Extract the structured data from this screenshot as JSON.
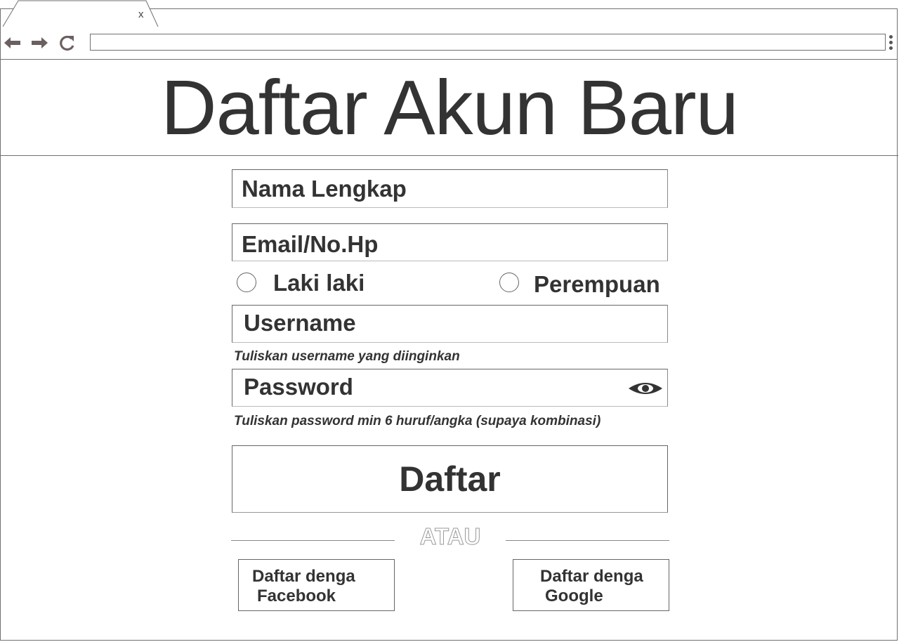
{
  "browser": {
    "tab": {
      "title": "",
      "close_glyph": "x"
    },
    "address_bar": {
      "value": "",
      "placeholder": ""
    },
    "icons": [
      "back-arrow-icon",
      "forward-arrow-icon",
      "reload-icon",
      "kebab-menu-icon"
    ]
  },
  "page": {
    "title": "Daftar Akun Baru"
  },
  "form": {
    "full_name": {
      "placeholder": "Nama Lengkap",
      "value": ""
    },
    "email_phone": {
      "placeholder": "Email/No.Hp",
      "value": ""
    },
    "gender": {
      "options": [
        {
          "label": "Laki laki",
          "selected": false
        },
        {
          "label": "Perempuan",
          "selected": false
        }
      ]
    },
    "username": {
      "placeholder": "Username",
      "value": "",
      "hint": "Tuliskan username yang diinginkan"
    },
    "password": {
      "placeholder": "Password",
      "value": "",
      "hint": "Tuliskan password min 6 huruf/angka (supaya kombinasi)",
      "toggle_icon": "eye-icon"
    },
    "submit_label": "Daftar",
    "divider_text": "ATAU",
    "social": {
      "facebook": {
        "line1": "Daftar denga",
        "line2": "Facebook"
      },
      "google": {
        "line1": "Daftar denga",
        "line2": "Google"
      }
    }
  },
  "colors": {
    "text": "#333333",
    "border": "#707070",
    "icon": "#6b6060",
    "background": "#ffffff"
  }
}
